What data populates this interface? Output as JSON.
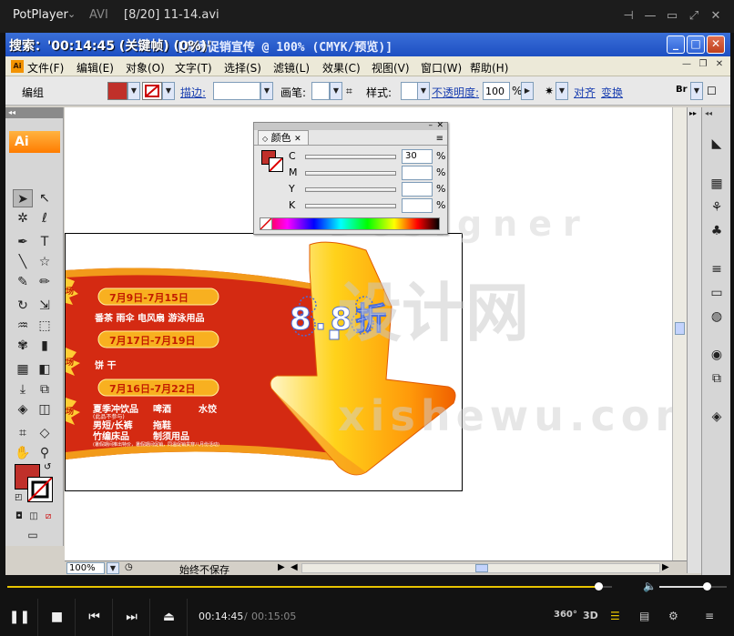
{
  "player": {
    "brand": "PotPlayer",
    "format": "AVI",
    "file_title": "[8/20] 11-14.avi",
    "time_current": "00:14:45",
    "time_separator": "/",
    "time_total": "00:15:05",
    "progress": 0.978,
    "volume": 0.7,
    "label_360": "360°",
    "label_3d": "3D"
  },
  "ai": {
    "window_title": "[商场促销宣传 @ 100% (CMYK/预览)]",
    "title_prefix": "… ob … llu … ",
    "overlay_text": "搜索：'00:14:45 (关键帧) (0%)'",
    "app_icon": "Ai",
    "menu": [
      "文件(F)",
      "编辑(E)",
      "对象(O)",
      "文字(T)",
      "选择(S)",
      "滤镜(L)",
      "效果(C)",
      "视图(V)",
      "窗口(W)",
      "帮助(H)"
    ],
    "control": {
      "group_label": "编组",
      "stroke_label": "描边:",
      "brush_label": "画笔:",
      "style_label": "样式:",
      "opacity_label": "不透明度:",
      "opacity_value": "100",
      "opacity_unit": "%",
      "align_label": "对齐",
      "transform_label": "变换"
    },
    "tools_logo": "Ai",
    "status": {
      "zoom": "100%",
      "save_state": "始终不保存"
    },
    "color_panel": {
      "tab": "颜色",
      "channels": [
        {
          "name": "C",
          "value": "30",
          "unit": "%"
        },
        {
          "name": "M",
          "value": "",
          "unit": "%"
        },
        {
          "name": "Y",
          "value": "",
          "unit": "%"
        },
        {
          "name": "K",
          "value": "",
          "unit": "%"
        }
      ]
    }
  },
  "artwork": {
    "date1": "7月9日-7月15日",
    "items1": "番茶  雨伞  电风扇  游泳用品",
    "date2": "7月17日-7月19日",
    "items2": "饼  干",
    "date3": "7月16日-7月22日",
    "items3a": "夏季冲饮品",
    "items3a_sub": "(此品不参与)",
    "items3b": "啤酒",
    "items3c": "水饺",
    "items3d": "男短/长裤",
    "items3e": "拖鞋",
    "items3f": "竹编床品",
    "items3g": "制须用品",
    "footnote": "(暑假期间推出特价，暑假期间促销，同温促销贯穿八月份活动)",
    "badge": "场",
    "badge2": "场",
    "badge3": "场",
    "discount": "8.8折"
  },
  "watermark": {
    "line1": "Designer",
    "line2": "设计网",
    "line3": "xishewu.com"
  },
  "colors": {
    "fill": "#c0302a",
    "banner_red": "#d42a12",
    "banner_yellow": "#f8b020",
    "arrow_orange": "#f7931e",
    "player_accent": "#e7c400"
  }
}
